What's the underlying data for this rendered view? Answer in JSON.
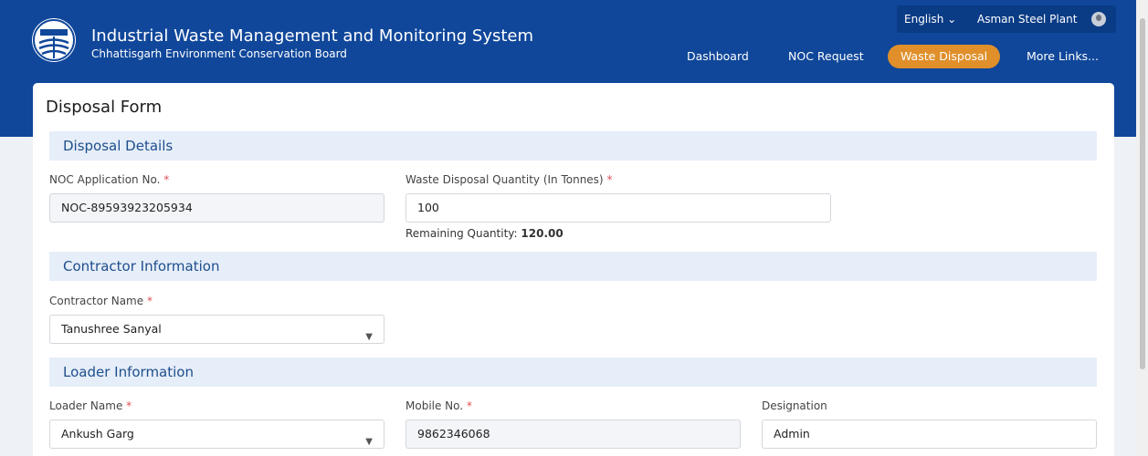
{
  "header": {
    "title": "Industrial Waste Management and Monitoring System",
    "subtitle": "Chhattisgarh Environment Conservation Board"
  },
  "top_bar": {
    "language": "English ⌄",
    "user_name": "Asman Steel Plant"
  },
  "nav": [
    {
      "label": "Dashboard"
    },
    {
      "label": "NOC Request"
    },
    {
      "label": "Waste Disposal",
      "active": true
    },
    {
      "label": "More Links..."
    }
  ],
  "form": {
    "title": "Disposal Form",
    "sections": {
      "disposal": "Disposal Details",
      "contractor": "Contractor Information",
      "loader": "Loader Information"
    },
    "noc_application": {
      "label": "NOC Application No.",
      "value": "NOC-89593923205934"
    },
    "disposal_quantity": {
      "label": "Waste Disposal Quantity (In Tonnes)",
      "value": "100"
    },
    "remaining": {
      "label": "Remaining Quantity:",
      "value": "120.00"
    },
    "contractor_name": {
      "label": "Contractor Name",
      "value": "Tanushree Sanyal"
    },
    "loader_name": {
      "label": "Loader Name",
      "value": "Ankush Garg"
    },
    "mobile_no": {
      "label": "Mobile No.",
      "value": "9862346068"
    },
    "designation": {
      "label": "Designation",
      "value": "Admin"
    },
    "required_mark": "*"
  },
  "colors": {
    "header_bg": "#10479a",
    "active_nav": "#e08f2b",
    "section_bg": "#e6eef9",
    "section_text": "#1e4e8c"
  },
  "icons": [
    "emblem-logo-icon",
    "user-avatar-icon",
    "chevron-down-icon"
  ]
}
